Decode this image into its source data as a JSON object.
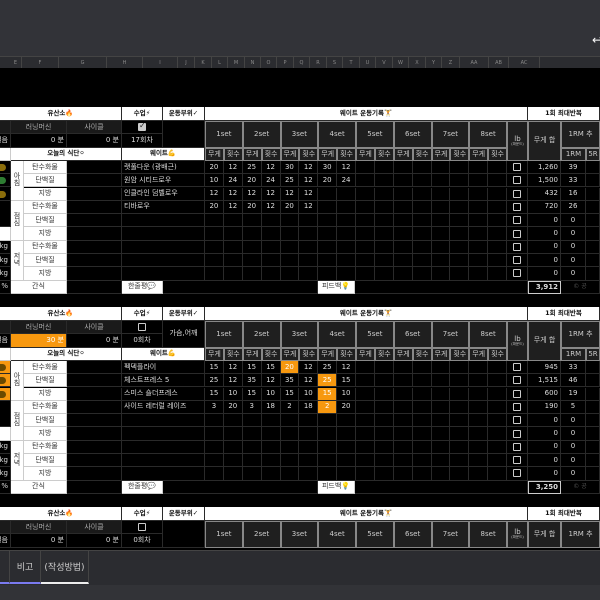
{
  "toolbar": {
    "undo_icon": "undo-arrow-icon",
    "undo_glyph": "↩"
  },
  "columns": [
    "E",
    "F",
    "G",
    "H",
    "I",
    "J",
    "K",
    "L",
    "M",
    "N",
    "O",
    "P",
    "Q",
    "R",
    "S",
    "T",
    "U",
    "V",
    "W",
    "X",
    "Y",
    "Z",
    "AA",
    "AB",
    "AC"
  ],
  "labels": {
    "cardio": "유산소🔥",
    "class": "수업⚡",
    "body_part": "운동부위✓",
    "weight_log": "웨이트 운동기록🏋",
    "max_rep": "1회 최대반복",
    "treadmill": "러닝머신",
    "cycle": "사이클",
    "steps": "걸음",
    "diet": "오늘의 식단⚪",
    "weight": "웨이트💪",
    "weight_col": "무게",
    "reps_col": "횟수",
    "lb": "lb",
    "lb_sub": "(파운드)",
    "weight_sum": "무게 합",
    "rm_header": "1RM 추",
    "rm1": "1RM",
    "rm5": "5R",
    "meals": [
      "아침",
      "점심",
      "저녁"
    ],
    "nutrients": [
      "탄수화물",
      "단백질",
      "지방"
    ],
    "snack": "간식",
    "review": "한줄평💬",
    "feedback": "피드백💡",
    "copyright": "© 공",
    "kg": "kg",
    "percent": "%",
    "sets": [
      "1set",
      "2set",
      "3set",
      "4set",
      "5set",
      "6set",
      "7set",
      "8set"
    ]
  },
  "colors": {
    "highlight": "#f7980f",
    "pill_olive": "#8a6d0b",
    "pill_green": "#2e7d32"
  },
  "sections": [
    {
      "treadmill": "0 분",
      "cycle": "0 분",
      "class_checked": true,
      "class_count": "17회차",
      "body_part": "",
      "treadmill_highlight": false,
      "pill_highlight": false,
      "exercises": [
        {
          "name": "랫풀다운 (광배근)",
          "sets": [
            [
              "20",
              "12"
            ],
            [
              "25",
              "12"
            ],
            [
              "30",
              "12"
            ],
            [
              "30",
              "12"
            ]
          ],
          "sum": "1,260",
          "rm": "39"
        },
        {
          "name": "원암 시티드로우",
          "sets": [
            [
              "10",
              "24"
            ],
            [
              "20",
              "24"
            ],
            [
              "25",
              "12"
            ],
            [
              "20",
              "24"
            ]
          ],
          "sum": "1,500",
          "rm": "33"
        },
        {
          "name": "인클라인 덤벨로우",
          "sets": [
            [
              "12",
              "12"
            ],
            [
              "12",
              "12"
            ],
            [
              "12",
              "12"
            ]
          ],
          "sum": "432",
          "rm": "16"
        },
        {
          "name": "티바로우",
          "sets": [
            [
              "20",
              "12"
            ],
            [
              "20",
              "12"
            ],
            [
              "20",
              "12"
            ]
          ],
          "sum": "720",
          "rm": "26"
        },
        {
          "name": "",
          "sets": [],
          "sum": "0",
          "rm": "0"
        },
        {
          "name": "",
          "sets": [],
          "sum": "0",
          "rm": "0"
        },
        {
          "name": "",
          "sets": [],
          "sum": "0",
          "rm": "0"
        },
        {
          "name": "",
          "sets": [],
          "sum": "0",
          "rm": "0"
        },
        {
          "name": "",
          "sets": [],
          "sum": "0",
          "rm": "0"
        }
      ],
      "highlights": [],
      "total": "3,912"
    },
    {
      "treadmill": "30 분",
      "cycle": "0 분",
      "class_checked": false,
      "class_count": "0회차",
      "body_part": "가슴,어깨",
      "treadmill_highlight": true,
      "pill_highlight": true,
      "exercises": [
        {
          "name": "펙덱플라이",
          "sets": [
            [
              "15",
              "12"
            ],
            [
              "15",
              "15"
            ],
            [
              "20",
              "12"
            ],
            [
              "25",
              "12"
            ]
          ],
          "sum": "945",
          "rm": "33"
        },
        {
          "name": "체스트프레스 5",
          "sets": [
            [
              "25",
              "12"
            ],
            [
              "35",
              "12"
            ],
            [
              "35",
              "12"
            ],
            [
              "25",
              "15"
            ]
          ],
          "sum": "1,515",
          "rm": "46"
        },
        {
          "name": "스미스 숄더프레스",
          "sets": [
            [
              "15",
              "10"
            ],
            [
              "15",
              "10"
            ],
            [
              "15",
              "10"
            ],
            [
              "15",
              "10"
            ]
          ],
          "sum": "600",
          "rm": "19"
        },
        {
          "name": "사이드 레터럴 레이즈",
          "sets": [
            [
              "3",
              "20"
            ],
            [
              "3",
              "18"
            ],
            [
              "2",
              "18"
            ],
            [
              "2",
              "20"
            ]
          ],
          "sum": "190",
          "rm": "5"
        },
        {
          "name": "",
          "sets": [],
          "sum": "0",
          "rm": "0"
        },
        {
          "name": "",
          "sets": [],
          "sum": "0",
          "rm": "0"
        },
        {
          "name": "",
          "sets": [],
          "sum": "0",
          "rm": "0"
        },
        {
          "name": "",
          "sets": [],
          "sum": "0",
          "rm": "0"
        },
        {
          "name": "",
          "sets": [],
          "sum": "0",
          "rm": "0"
        }
      ],
      "highlights": [
        [
          0,
          2
        ],
        [
          1,
          3
        ],
        [
          2,
          3
        ],
        [
          3,
          3
        ]
      ],
      "total": "3,250"
    },
    {
      "treadmill": "0 분",
      "cycle": "0 분",
      "class_checked": false,
      "class_count": "0회차",
      "body_part": "",
      "treadmill_highlight": false,
      "pill_highlight": false,
      "exercises": [],
      "highlights": [],
      "total": ""
    }
  ],
  "tabs": [
    {
      "label": "비고"
    },
    {
      "label": "(작성방법)"
    }
  ]
}
